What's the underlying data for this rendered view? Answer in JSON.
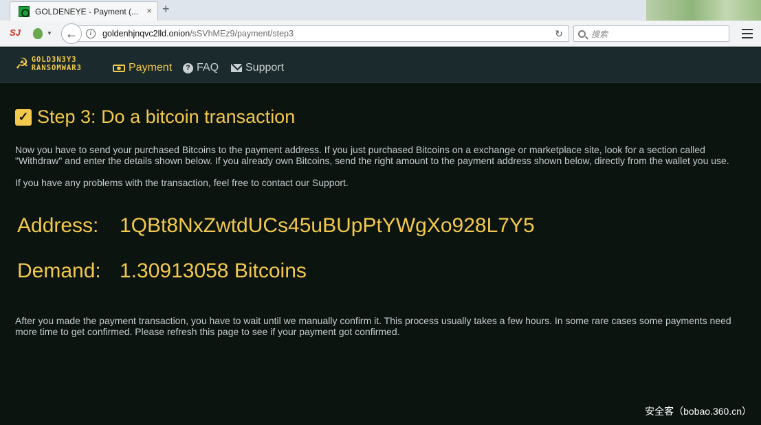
{
  "browser": {
    "tab_title": "GOLDENEYE - Payment (...",
    "tab_close": "×",
    "new_tab": "+",
    "toolbar_sj": "SJ",
    "back_glyph": "←",
    "info_glyph": "i",
    "url_host": "goldenhjnqvc2lld.onion",
    "url_path": "/sSVhMEz9/payment/step3",
    "reload_glyph": "↻",
    "search_placeholder": "搜索",
    "icons": [
      "site-favicon",
      "sj-icon",
      "extension-icon",
      "back-icon",
      "info-icon",
      "reload-icon",
      "search-icon",
      "menu-icon"
    ]
  },
  "site_nav": {
    "logo_line1": "GOLD3N3Y3",
    "logo_line2": "RANSOMWAR3",
    "logo_glyph": "☭",
    "links": [
      {
        "label": "Payment",
        "active": true
      },
      {
        "label": "FAQ",
        "active": false
      },
      {
        "label": "Support",
        "active": false
      }
    ],
    "faq_glyph": "?"
  },
  "main": {
    "check_glyph": "✓",
    "title": "Step 3: Do a bitcoin transaction",
    "paragraph1": "Now you have to send your purchased Bitcoins to the payment address. If you just purchased Bitcoins on a exchange or marketplace site, look for a section called \"Withdraw\" and enter the details shown below. If you already own Bitcoins, send the right amount to the payment address shown below, directly from the wallet you use.",
    "paragraph2": "If you have any problems with the transaction, feel free to contact our Support.",
    "address_label": "Address:",
    "address_value": "1QBt8NxZwtdUCs45uBUpPtYWgXo928L7Y5",
    "demand_label": "Demand:",
    "demand_value": "1.30913058 Bitcoins",
    "paragraph3": "After you made the payment transaction, you have to wait until we manually confirm it. This process usually takes a few hours. In some rare cases some payments need more time to get confirmed. Please refresh this page to see if your payment got confirmed."
  },
  "watermark": "安全客（bobao.360.cn）",
  "colors": {
    "accent": "#f2c94c",
    "page_bg": "#0c1410",
    "nav_bg": "#1b2a2c",
    "text": "#c7cccf"
  }
}
